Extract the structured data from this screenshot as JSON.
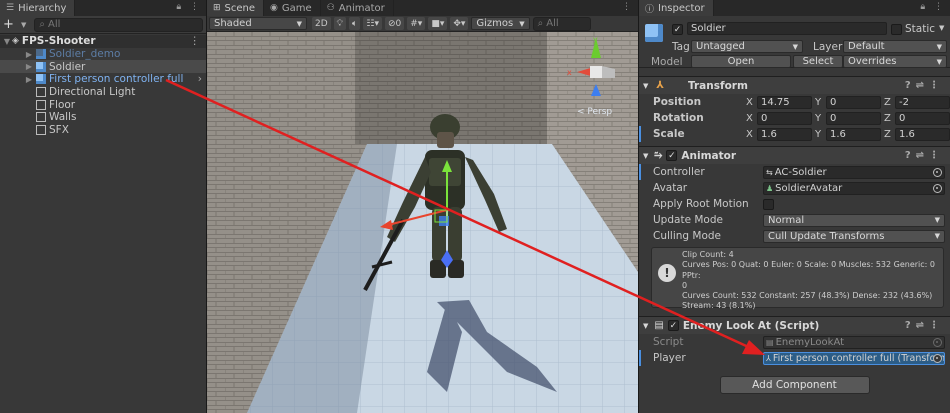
{
  "colors": {
    "accent": "#4a8fe0",
    "arrow": "#e02020",
    "prefab_blue": "#7fb2f0",
    "selection": "#2c5d87"
  },
  "hierarchy": {
    "tab": "Hierarchy",
    "add_label": "+",
    "search_placeholder": "All",
    "scene_name": "FPS-Shooter",
    "items": [
      {
        "label": "Soldier_demo",
        "style": "disabled"
      },
      {
        "label": "Soldier",
        "style": "selected"
      },
      {
        "label": "First person controller full",
        "style": "prefab"
      },
      {
        "label": "Directional Light",
        "style": "normal"
      },
      {
        "label": "Floor",
        "style": "normal"
      },
      {
        "label": "Walls",
        "style": "normal"
      },
      {
        "label": "SFX",
        "style": "normal"
      }
    ]
  },
  "scene": {
    "tabs": [
      "Scene",
      "Game",
      "Animator"
    ],
    "shading": "Shaded",
    "mode_2d": "2D",
    "hidden_count": "0",
    "gizmos": "Gizmos",
    "search_placeholder": "All",
    "persp": "< Persp"
  },
  "inspector": {
    "tab": "Inspector",
    "object_name": "Soldier",
    "static_label": "Static",
    "tag_label": "Tag",
    "tag_value": "Untagged",
    "layer_label": "Layer",
    "layer_value": "Default",
    "model_label": "Model",
    "open_label": "Open",
    "select_label": "Select",
    "overrides_label": "Overrides",
    "transform": {
      "title": "Transform",
      "rows": [
        {
          "label": "Position",
          "x": "14.75",
          "y": "0",
          "z": "-2"
        },
        {
          "label": "Rotation",
          "x": "0",
          "y": "0",
          "z": "0"
        },
        {
          "label": "Scale",
          "x": "1.6",
          "y": "1.6",
          "z": "1.6"
        }
      ],
      "axis_x": "X",
      "axis_y": "Y",
      "axis_z": "Z"
    },
    "animator": {
      "title": "Animator",
      "controller_label": "Controller",
      "controller_value": "AC-Soldier",
      "avatar_label": "Avatar",
      "avatar_value": "SoldierAvatar",
      "root_motion_label": "Apply Root Motion",
      "update_mode_label": "Update Mode",
      "update_mode_value": "Normal",
      "culling_label": "Culling Mode",
      "culling_value": "Cull Update Transforms",
      "info": [
        "Clip Count: 4",
        "Curves Pos: 0 Quat: 0 Euler: 0 Scale: 0 Muscles: 532 Generic: 0 PPtr:",
        "0",
        "Curves Count: 532 Constant: 257 (48.3%) Dense: 232 (43.6%)",
        "Stream: 43 (8.1%)"
      ]
    },
    "script": {
      "title": "Enemy Look At (Script)",
      "script_label": "Script",
      "script_value": "EnemyLookAt",
      "player_label": "Player",
      "player_value": "First person controller full (Transform)"
    },
    "add_component": "Add Component"
  }
}
